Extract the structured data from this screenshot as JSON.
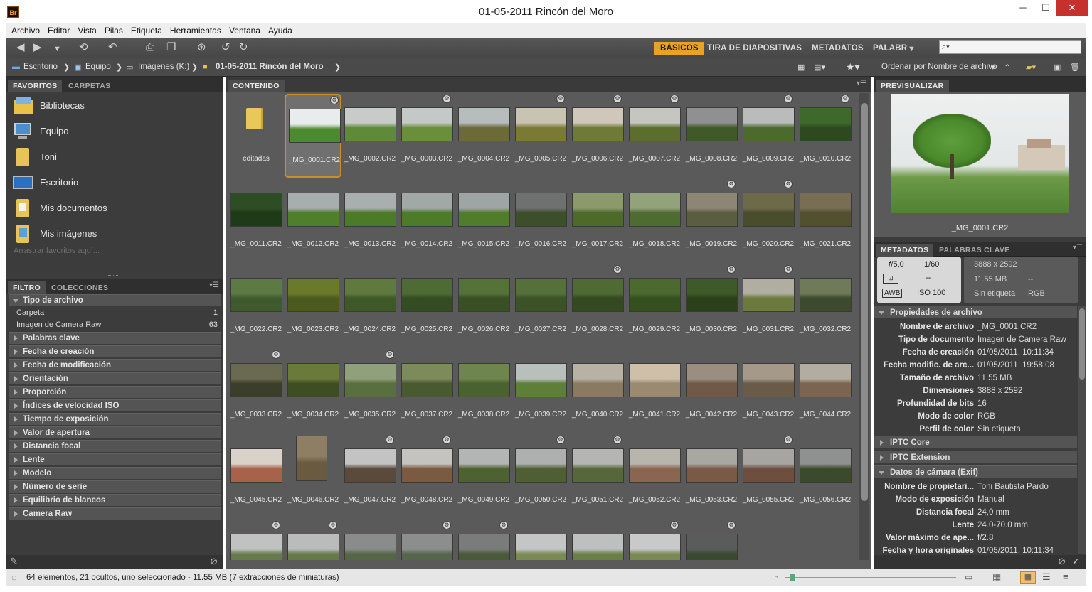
{
  "window": {
    "title": "01-05-2011 Rincón del Moro",
    "app_logo": "Br",
    "minimize": "─",
    "maximize": "☐",
    "close": "✕"
  },
  "menu": [
    "Archivo",
    "Editar",
    "Vista",
    "Pilas",
    "Etiqueta",
    "Herramientas",
    "Ventana",
    "Ayuda"
  ],
  "workspaces": {
    "basicos": "BÁSICOS",
    "tira": "TIRA DE DIAPOSITIVAS",
    "metadatos": "METADATOS",
    "palabr": "PALABR"
  },
  "search": {
    "placeholder": "",
    "icon": "magnifier-icon",
    "value": "⌕▾"
  },
  "path": {
    "escritorio": "Escritorio",
    "equipo": "Equipo",
    "imagenes": "Imágenes (K:)",
    "folder": "01-05-2011 Rincón del Moro"
  },
  "sort": {
    "label": "Ordenar por Nombre de archivo"
  },
  "left": {
    "tabs": {
      "favoritos": "FAVORITOS",
      "carpetas": "CARPETAS"
    },
    "favorites": [
      "Bibliotecas",
      "Equipo",
      "Toni",
      "Escritorio",
      "Mis documentos",
      "Mis imágenes"
    ],
    "drag_hint": "Arrastrar favoritos aquí...",
    "filter_tabs": {
      "filtro": "FILTRO",
      "colecciones": "COLECCIONES"
    },
    "filter_open": "Tipo de archivo",
    "filter_rows": [
      {
        "label": "Carpeta",
        "count": "1"
      },
      {
        "label": "Imagen de Camera Raw",
        "count": "63"
      }
    ],
    "filter_groups": [
      "Palabras clave",
      "Fecha de creación",
      "Fecha de modificación",
      "Orientación",
      "Proporción",
      "Índices de velocidad ISO",
      "Tiempo de exposición",
      "Valor de apertura",
      "Distancia focal",
      "Lente",
      "Modelo",
      "Número de serie",
      "Equilibrio de blancos",
      "Camera Raw"
    ]
  },
  "content": {
    "tab": "CONTENIDO",
    "items": [
      {
        "name": "editadas",
        "kind": "folder"
      },
      {
        "name": "_MG_0001.CR2",
        "c1": "#e9ecec",
        "c2": "#4d8a2f"
      },
      {
        "name": "_MG_0002.CR2",
        "c1": "#c8ccc9",
        "c2": "#5e8a3a"
      },
      {
        "name": "_MG_0003.CR2",
        "c1": "#c4c8c6",
        "c2": "#6a8f3b"
      },
      {
        "name": "_MG_0004.CR2",
        "c1": "#b7bcbd",
        "c2": "#6b6a38"
      },
      {
        "name": "_MG_0005.CR2",
        "c1": "#c9c3b2",
        "c2": "#7b7a35"
      },
      {
        "name": "_MG_0006.CR2",
        "c1": "#cfc8ba",
        "c2": "#6f7a36"
      },
      {
        "name": "_MG_0007.CR2",
        "c1": "#c6c6c0",
        "c2": "#5c6e2e"
      },
      {
        "name": "_MG_0008.CR2",
        "c1": "#8e9091",
        "c2": "#3f5a26"
      },
      {
        "name": "_MG_0009.CR2",
        "c1": "#b9bcbb",
        "c2": "#4c6a2e"
      },
      {
        "name": "_MG_0010.CR2",
        "c1": "#3d6a2c",
        "c2": "#2c4a1e"
      },
      {
        "name": "_MG_0011.CR2",
        "c1": "#2d4d24",
        "c2": "#1f3a18"
      },
      {
        "name": "_MG_0012.CR2",
        "c1": "#a8aeae",
        "c2": "#4e7f2a"
      },
      {
        "name": "_MG_0013.CR2",
        "c1": "#a9afae",
        "c2": "#4b7a28"
      },
      {
        "name": "_MG_0014.CR2",
        "c1": "#a2a8a6",
        "c2": "#4c7b2a"
      },
      {
        "name": "_MG_0015.CR2",
        "c1": "#9fa5a4",
        "c2": "#4f7d2b"
      },
      {
        "name": "_MG_0016.CR2",
        "c1": "#6f7070",
        "c2": "#3d4e2a"
      },
      {
        "name": "_MG_0017.CR2",
        "c1": "#8a9a6a",
        "c2": "#4d6a2b"
      },
      {
        "name": "_MG_0018.CR2",
        "c1": "#92a27a",
        "c2": "#4e6b31"
      },
      {
        "name": "_MG_0019.CR2",
        "c1": "#8e8674",
        "c2": "#5a5d3f"
      },
      {
        "name": "_MG_0020.CR2",
        "c1": "#6d6a4a",
        "c2": "#4a4d2c"
      },
      {
        "name": "_MG_0021.CR2",
        "c1": "#796d54",
        "c2": "#53502f"
      },
      {
        "name": "_MG_0022.CR2",
        "c1": "#5d7a45",
        "c2": "#3f5a2c"
      },
      {
        "name": "_MG_0023.CR2",
        "c1": "#6b7a2a",
        "c2": "#4c5a1e"
      },
      {
        "name": "_MG_0024.CR2",
        "c1": "#5f7a3c",
        "c2": "#3e5828"
      },
      {
        "name": "_MG_0025.CR2",
        "c1": "#4f6b34",
        "c2": "#344c22"
      },
      {
        "name": "_MG_0026.CR2",
        "c1": "#557238",
        "c2": "#385024"
      },
      {
        "name": "_MG_0027.CR2",
        "c1": "#56703b",
        "c2": "#3a5226"
      },
      {
        "name": "_MG_0028.CR2",
        "c1": "#4f6a32",
        "c2": "#33491f"
      },
      {
        "name": "_MG_0029.CR2",
        "c1": "#4c6a2e",
        "c2": "#34501f"
      },
      {
        "name": "_MG_0030.CR2",
        "c1": "#3d5a28",
        "c2": "#2a4019"
      },
      {
        "name": "_MG_0031.CR2",
        "c1": "#b1ada0",
        "c2": "#6d7a3e"
      },
      {
        "name": "_MG_0032.CR2",
        "c1": "#6f7a58",
        "c2": "#3e4a2e"
      },
      {
        "name": "_MG_0033.CR2",
        "c1": "#6a6a50",
        "c2": "#3b3e2a"
      },
      {
        "name": "_MG_0034.CR2",
        "c1": "#6a7a3a",
        "c2": "#3e4e22"
      },
      {
        "name": "_MG_0035.CR2",
        "c1": "#8fa07a",
        "c2": "#5a6f3e"
      },
      {
        "name": "_MG_0037.CR2",
        "c1": "#7d8a5a",
        "c2": "#4a5a30"
      },
      {
        "name": "_MG_0038.CR2",
        "c1": "#6f8550",
        "c2": "#4a6230"
      },
      {
        "name": "_MG_0039.CR2",
        "c1": "#b9c0bc",
        "c2": "#5d7f38"
      },
      {
        "name": "_MG_0040.CR2",
        "c1": "#b8b2a4",
        "c2": "#8a7a62"
      },
      {
        "name": "_MG_0041.CR2",
        "c1": "#cdbfa8",
        "c2": "#9a8a70"
      },
      {
        "name": "_MG_0042.CR2",
        "c1": "#9a8e80",
        "c2": "#6e5a46"
      },
      {
        "name": "_MG_0043.CR2",
        "c1": "#a59a8a",
        "c2": "#6a5a48"
      },
      {
        "name": "_MG_0044.CR2",
        "c1": "#b3aca0",
        "c2": "#7a6650"
      },
      {
        "name": "_MG_0045.CR2",
        "c1": "#d9d2c8",
        "c2": "#a9624a"
      },
      {
        "name": "_MG_0046.CR2",
        "c1": "#8e7e64",
        "c2": "#6a5a40"
      },
      {
        "name": "_MG_0047.CR2",
        "c1": "#c2c3c2",
        "c2": "#5a4a3c"
      },
      {
        "name": "_MG_0048.CR2",
        "c1": "#c4c3bf",
        "c2": "#7a5a40"
      },
      {
        "name": "_MG_0049.CR2",
        "c1": "#b3b5b4",
        "c2": "#4e6131"
      },
      {
        "name": "_MG_0050.CR2",
        "c1": "#aeb0af",
        "c2": "#4f5f33"
      },
      {
        "name": "_MG_0051.CR2",
        "c1": "#b5b6b4",
        "c2": "#56673a"
      },
      {
        "name": "_MG_0052.CR2",
        "c1": "#b8b5ad",
        "c2": "#8a6650"
      },
      {
        "name": "_MG_0053.CR2",
        "c1": "#a9a7a2",
        "c2": "#7a5a46"
      },
      {
        "name": "_MG_0055.CR2",
        "c1": "#a6a5a1",
        "c2": "#6e4e3e"
      },
      {
        "name": "_MG_0056.CR2",
        "c1": "#8f9090",
        "c2": "#3c4a2c"
      },
      {
        "name": "",
        "c1": "#bfc2c0",
        "c2": "#667a4a"
      },
      {
        "name": "",
        "c1": "#b9bcba",
        "c2": "#667a48"
      },
      {
        "name": "",
        "c1": "#8a8c8c",
        "c2": "#556646"
      },
      {
        "name": "",
        "c1": "#8c8e8e",
        "c2": "#55664a"
      },
      {
        "name": "",
        "c1": "#7a7c7c",
        "c2": "#4a5a38"
      },
      {
        "name": "",
        "c1": "#c3c6c4",
        "c2": "#7a8a50"
      },
      {
        "name": "",
        "c1": "#bdc0be",
        "c2": "#6a7f44"
      },
      {
        "name": "",
        "c1": "#c7cac8",
        "c2": "#7a8a52"
      },
      {
        "name": "",
        "c1": "#5a5c5c",
        "c2": "#3a4a30"
      }
    ]
  },
  "right": {
    "preview_tab": "PREVISUALIZAR",
    "preview_name": "_MG_0001.CR2",
    "meta_tabs": {
      "metadatos": "METADATOS",
      "palabras": "PALABRAS CLAVE"
    },
    "exposure": {
      "aperture": "𝑓/5,0",
      "shutter": "1/60",
      "metering": "--",
      "iso": "ISO 100",
      "awb": "AWB",
      "dims": "3888 x 2592",
      "size": "11.55 MB",
      "size2": "--",
      "label": "Sin etiqueta",
      "mode": "RGB"
    },
    "file_props_title": "Propiedades de archivo",
    "file_props": [
      {
        "k": "Nombre de archivo",
        "v": "_MG_0001.CR2"
      },
      {
        "k": "Tipo de documento",
        "v": "Imagen de Camera Raw"
      },
      {
        "k": "Fecha de creación",
        "v": "01/05/2011, 10:11:34"
      },
      {
        "k": "Fecha modific. de arc...",
        "v": "01/05/2011, 19:58:08"
      },
      {
        "k": "Tamaño de archivo",
        "v": "11.55 MB"
      },
      {
        "k": "Dimensiones",
        "v": "3888 x 2592"
      },
      {
        "k": "Profundidad de bits",
        "v": "16"
      },
      {
        "k": "Modo de color",
        "v": "RGB"
      },
      {
        "k": "Perfil de color",
        "v": "Sin etiqueta"
      }
    ],
    "iptc_core": "IPTC Core",
    "iptc_ext": "IPTC Extension",
    "exif_title": "Datos de cámara (Exif)",
    "exif": [
      {
        "k": "Nombre de propietari...",
        "v": "Toni Bautista Pardo"
      },
      {
        "k": "Modo de exposición",
        "v": "Manual"
      },
      {
        "k": "Distancia focal",
        "v": "24,0 mm"
      },
      {
        "k": "Lente",
        "v": "24.0-70.0 mm"
      },
      {
        "k": "Valor máximo de ape...",
        "v": "f/2.8"
      },
      {
        "k": "Fecha y hora originales",
        "v": "01/05/2011, 10:11:34"
      }
    ]
  },
  "status": {
    "text": "64 elementos, 21 ocultos, uno seleccionado - 11.55 MB (7 extracciones de miniaturas)"
  }
}
